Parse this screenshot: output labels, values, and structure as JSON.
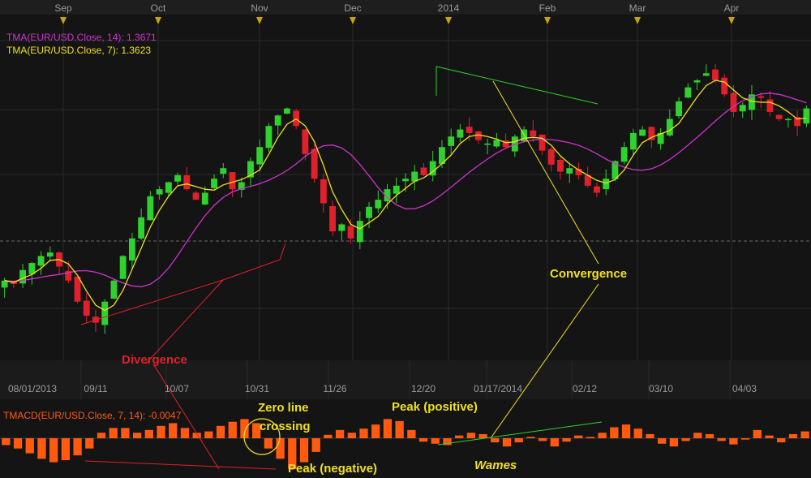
{
  "top_months": [
    "Sep",
    "Oct",
    "Nov",
    "Dec",
    "2014",
    "Feb",
    "Mar",
    "Apr"
  ],
  "legend": {
    "tma14": "TMA(EUR/USD.Close, 14): 1.3671",
    "tma7": "TMA(EUR/USD.Close, 7): 1.3623"
  },
  "date_axis": [
    "08/01/2013",
    "09/11",
    "10/07",
    "10/31",
    "11/26",
    "12/20",
    "01/17/2014",
    "02/12",
    "03/10",
    "04/03"
  ],
  "macd_label": "TMACD(EUR/USD.Close, 7, 14): -0.0047",
  "annotations": {
    "divergence": "Divergence",
    "convergence": "Convergence",
    "zero_line_1": "Zero line",
    "zero_line_2": "crossing",
    "peak_positive": "Peak (positive)",
    "peak_negative": "Peak (negative)",
    "wames": "Wames"
  },
  "colors": {
    "background": "#141414",
    "up_candle": "#2fd12f",
    "down_candle": "#e0202a",
    "tma14": "#cc33cc",
    "tma7": "#f0e020",
    "macd_bar": "#ff5a10",
    "annotation_red": "#e0202a",
    "annotation_yellow": "#f0e020",
    "annotation_green": "#2fd12f"
  },
  "chart_data": [
    {
      "type": "candlestick",
      "title": "EUR/USD",
      "xlabel": "",
      "ylabel": "",
      "close_approx": [
        1.326,
        1.325,
        1.329,
        1.331,
        1.333,
        1.334,
        1.33,
        1.326,
        1.32,
        1.316,
        1.314,
        1.32,
        1.326,
        1.333,
        1.338,
        1.344,
        1.35,
        1.352,
        1.354,
        1.356,
        1.352,
        1.349,
        1.351,
        1.355,
        1.358,
        1.352,
        1.354,
        1.36,
        1.364,
        1.37,
        1.373,
        1.375,
        1.37,
        1.362,
        1.355,
        1.348,
        1.34,
        1.342,
        1.338,
        1.343,
        1.347,
        1.349,
        1.352,
        1.353,
        1.355,
        1.357,
        1.356,
        1.36,
        1.364,
        1.367,
        1.369,
        1.368,
        1.366,
        1.365,
        1.366,
        1.364,
        1.367,
        1.369,
        1.367,
        1.363,
        1.359,
        1.357,
        1.358,
        1.356,
        1.353,
        1.351,
        1.355,
        1.36,
        1.364,
        1.368,
        1.369,
        1.366,
        1.368,
        1.372,
        1.377,
        1.381,
        1.383,
        1.385,
        1.383,
        1.379,
        1.374,
        1.376,
        1.379,
        1.378,
        1.374,
        1.372,
        1.372,
        1.37,
        1.375
      ],
      "series": [
        {
          "name": "TMA(EUR/USD.Close, 14)",
          "last": 1.3671
        },
        {
          "name": "TMA(EUR/USD.Close, 7)",
          "last": 1.3623
        }
      ]
    },
    {
      "type": "bar",
      "title": "TMACD(EUR/USD.Close, 7, 14)",
      "last": -0.0047,
      "values_approx": [
        -0.001,
        -0.0015,
        -0.0022,
        -0.003,
        -0.0035,
        -0.0032,
        -0.0025,
        -0.0015,
        0.0008,
        0.0015,
        0.0015,
        0.0008,
        0.0012,
        0.0018,
        0.0022,
        0.0015,
        0.0008,
        0.001,
        0.0018,
        0.0024,
        0.0028,
        0.0022,
        -0.0015,
        -0.003,
        -0.0045,
        -0.0035,
        -0.002,
        0.0005,
        0.0012,
        0.0008,
        0.0014,
        0.002,
        0.0028,
        0.0025,
        0.0012,
        -0.0005,
        -0.0008,
        -0.001,
        0.0004,
        0.0008,
        0.0006,
        -0.0006,
        -0.0012,
        -0.0006,
        0.0002,
        -0.0004,
        -0.0012,
        -0.0005,
        0.0004,
        0.0002,
        0.0008,
        0.0016,
        0.002,
        0.0014,
        0.0006,
        -0.0008,
        -0.0012,
        -0.0004,
        0.0008,
        0.0006,
        -0.0004,
        -0.0009,
        -0.0002,
        0.0012,
        0.0004,
        -0.0006,
        0.0006,
        0.001
      ]
    }
  ]
}
